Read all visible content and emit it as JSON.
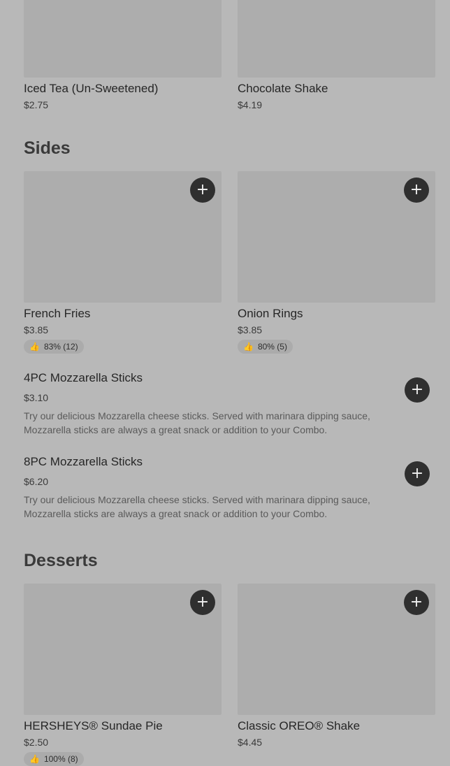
{
  "drinks": [
    {
      "name": "Iced Tea (Un-Sweetened)",
      "price": "$2.75"
    },
    {
      "name": "Chocolate Shake",
      "price": "$4.19"
    }
  ],
  "sides": {
    "title": "Sides",
    "cards": [
      {
        "name": "French Fries",
        "price": "$3.85",
        "rating": "83% (12)"
      },
      {
        "name": "Onion Rings",
        "price": "$3.85",
        "rating": "80% (5)"
      }
    ],
    "list": [
      {
        "name": "4PC Mozzarella Sticks",
        "price": "$3.10",
        "description": "Try our delicious Mozzarella cheese sticks. Served with marinara dipping sauce, Mozzarella sticks are always a great snack or addition to your Combo."
      },
      {
        "name": "8PC Mozzarella Sticks",
        "price": "$6.20",
        "description": "Try our delicious Mozzarella cheese sticks. Served with marinara dipping sauce, Mozzarella sticks are always a great snack or addition to your Combo."
      }
    ]
  },
  "desserts": {
    "title": "Desserts",
    "cards": [
      {
        "name": "HERSHEYS® Sundae Pie",
        "price": "$2.50",
        "rating": "100% (8)"
      },
      {
        "name": "Classic OREO® Shake",
        "price": "$4.45"
      }
    ]
  },
  "icons": {
    "add": "plus-icon",
    "rating": "thumbs-up-icon"
  },
  "colors": {
    "background": "#b8b8b8",
    "image_placeholder": "#adadad",
    "add_button": "#2f2f2f"
  }
}
